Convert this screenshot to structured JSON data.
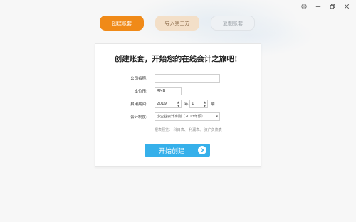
{
  "window": {
    "help_icon": "help-circle-icon",
    "minimize_icon": "minimize-icon",
    "restore_icon": "restore-icon",
    "close_icon": "close-icon"
  },
  "tabs": [
    {
      "label": "创建账套"
    },
    {
      "label": "导入第三方"
    },
    {
      "label": "复制账套"
    }
  ],
  "form": {
    "title": "创建账套，开始您的在线会计之旅吧！",
    "company_label": "公司名称:",
    "company_value": "",
    "currency_label": "本位币:",
    "currency_value": "RMB",
    "period_label": "启用期间:",
    "year_value": "2019",
    "year_unit": "年",
    "month_value": "1",
    "month_unit": "期",
    "standard_label": "会计制度:",
    "standard_value": "小企业会计准则（2013年颁）",
    "hint": "报表预览：  科目表、  利润表、  资产负债表",
    "submit_label": "开始创建"
  },
  "colors": {
    "accent_orange": "#f08a18",
    "primary_blue": "#36b0ea"
  }
}
